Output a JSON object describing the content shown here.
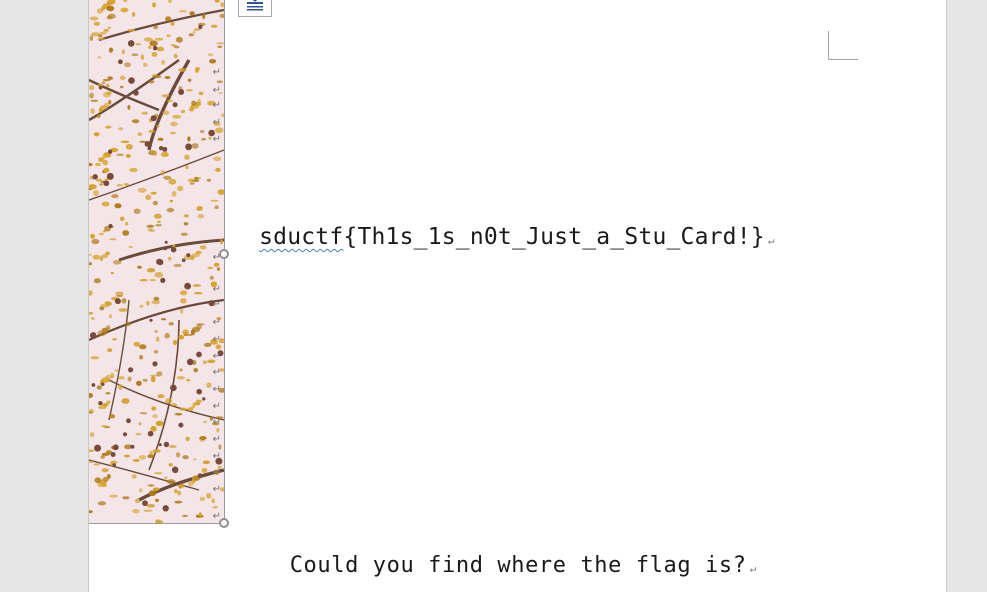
{
  "document": {
    "flag_prefix": "sductf",
    "flag_rest": "{Th1s_1s_n0t_Just_a_Stu_Card!}",
    "question": "Could you find where the flag is?",
    "paragraph_mark": "↵"
  },
  "image": {
    "subject": "tree branches with golden-yellow leaves against pale pink sky",
    "colors": {
      "sky": "#f4e6e8",
      "leaf": "#d6a12a",
      "leaf_dark": "#b07a16",
      "branch": "#6b4a3a"
    }
  },
  "icons": {
    "layout_options": "layout-options-icon",
    "anchor": "anchor-icon"
  },
  "colors": {
    "workspace": "#e6e6e6",
    "page": "#ffffff",
    "spell_underline": "#4a7fc1"
  }
}
